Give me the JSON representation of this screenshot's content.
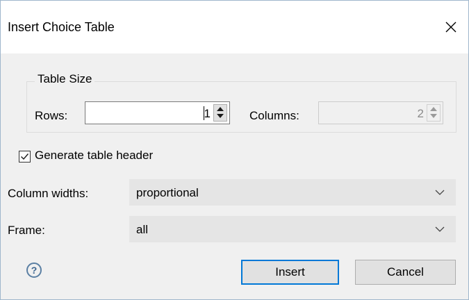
{
  "window": {
    "title": "Insert Choice Table"
  },
  "table_size": {
    "legend": "Table Size",
    "rows_label": "Rows:",
    "rows_value": "1",
    "columns_label": "Columns:",
    "columns_value": "2"
  },
  "header_checkbox": {
    "label": "Generate table header",
    "checked": true
  },
  "column_widths": {
    "label": "Column widths:",
    "value": "proportional"
  },
  "frame": {
    "label": "Frame:",
    "value": "all"
  },
  "buttons": {
    "help": "?",
    "insert": "Insert",
    "cancel": "Cancel"
  },
  "colors": {
    "default_button_border": "#0078d7",
    "dialog_bg": "#f0f0f0",
    "help_icon": "#3d6690"
  }
}
